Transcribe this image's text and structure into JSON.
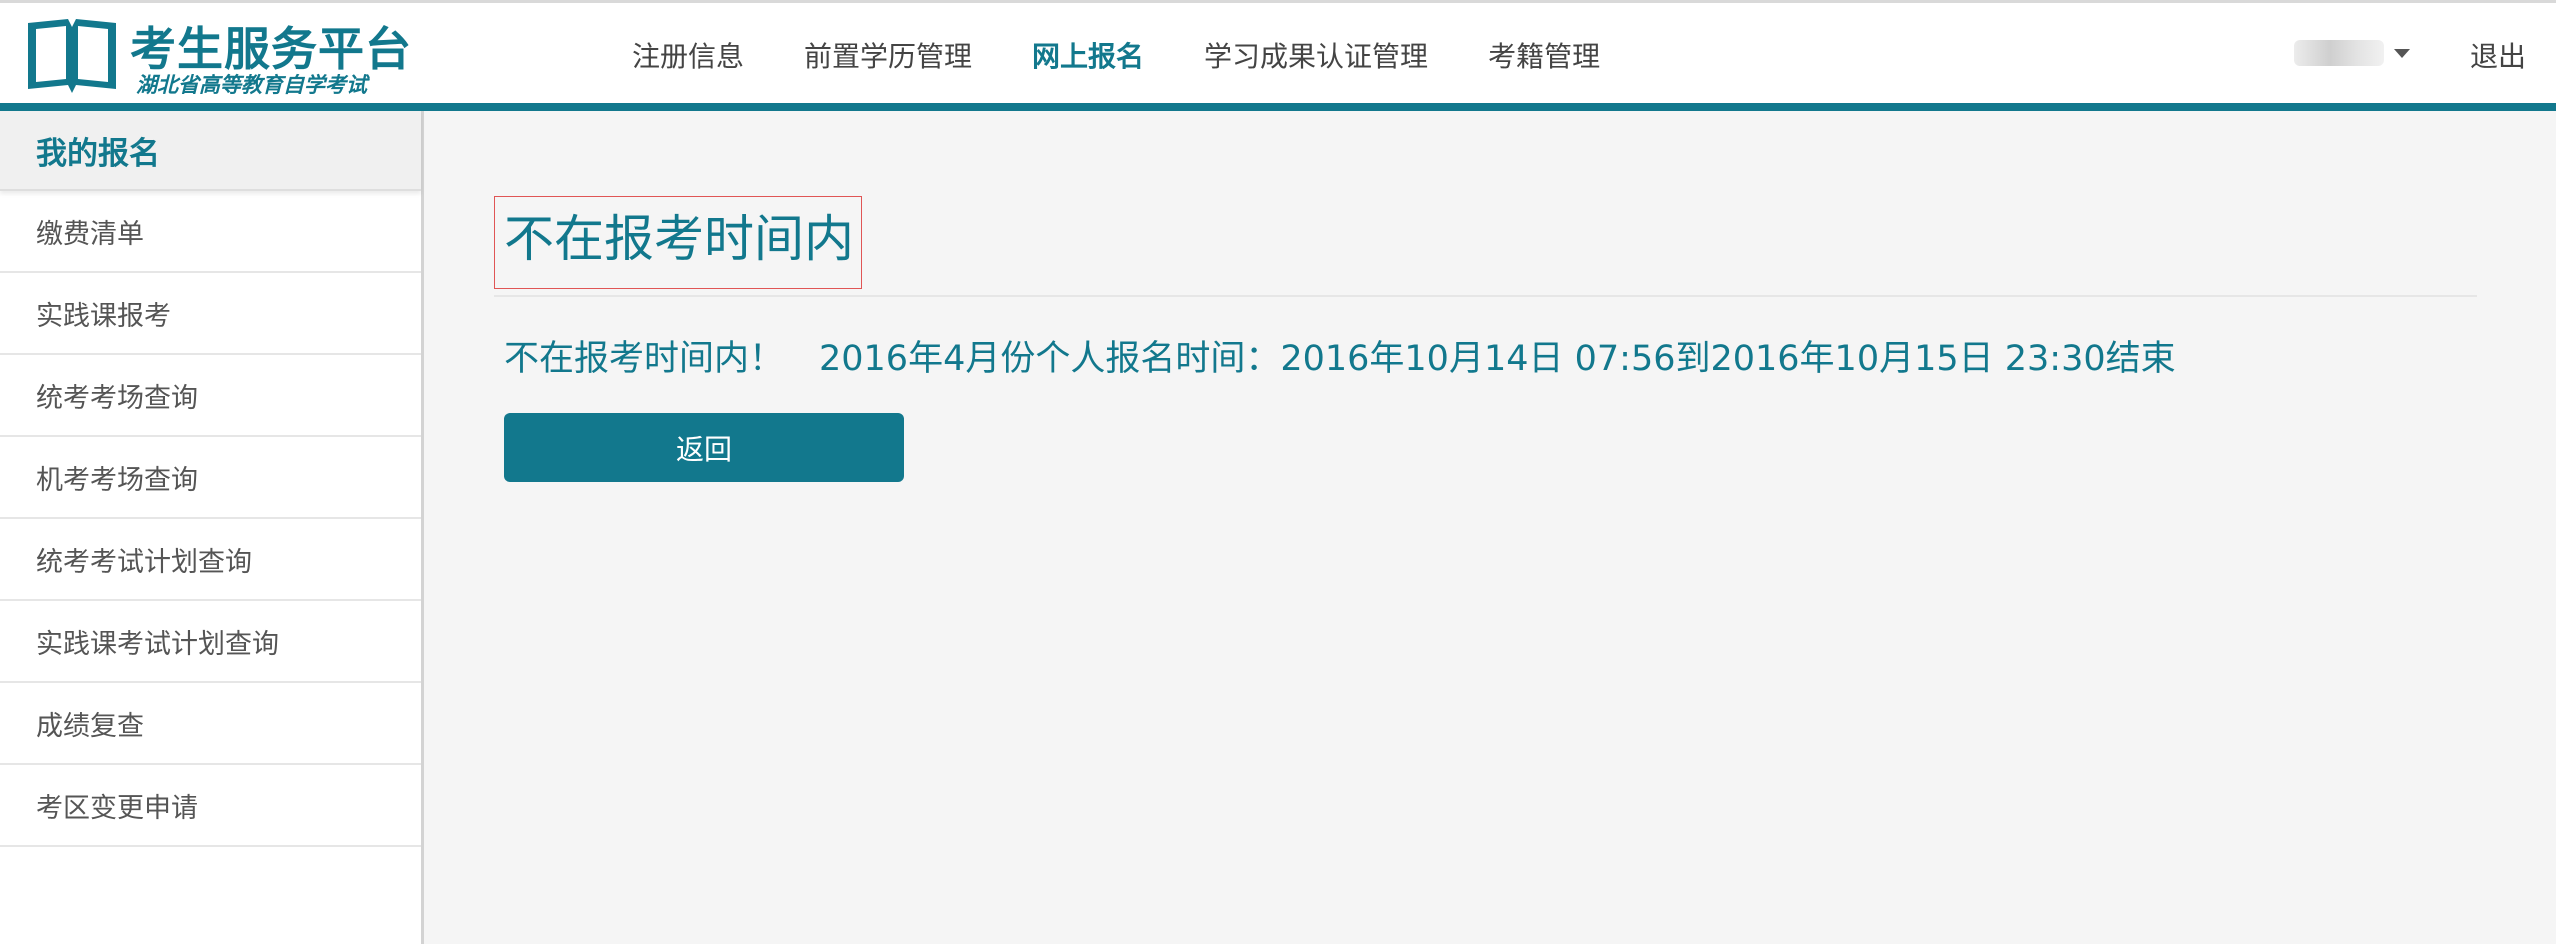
{
  "header": {
    "logo": {
      "title": "考生服务平台",
      "subtitle": "湖北省高等教育自学考试",
      "icon": "open-book-icon"
    },
    "nav": [
      {
        "label": "注册信息",
        "active": false
      },
      {
        "label": "前置学历管理",
        "active": false
      },
      {
        "label": "网上报名",
        "active": true
      },
      {
        "label": "学习成果认证管理",
        "active": false
      },
      {
        "label": "考籍管理",
        "active": false
      }
    ],
    "user_menu_icon": "caret-down-icon",
    "logout_label": "退出"
  },
  "sidebar": {
    "heading": "我的报名",
    "items": [
      {
        "label": "缴费清单"
      },
      {
        "label": "实践课报考"
      },
      {
        "label": "统考考场查询"
      },
      {
        "label": "机考考场查询"
      },
      {
        "label": "统考考试计划查询"
      },
      {
        "label": "实践课考试计划查询"
      },
      {
        "label": "成绩复查"
      },
      {
        "label": "考区变更申请"
      }
    ]
  },
  "main": {
    "title": "不在报考时间内",
    "message": "不在报考时间内！　2016年4月份个人报名时间：2016年10月14日 07:56到2016年10月15日 23:30结束",
    "back_label": "返回"
  },
  "colors": {
    "accent": "#12788d",
    "title_box_border": "#e05555",
    "background": "#f5f5f5"
  }
}
